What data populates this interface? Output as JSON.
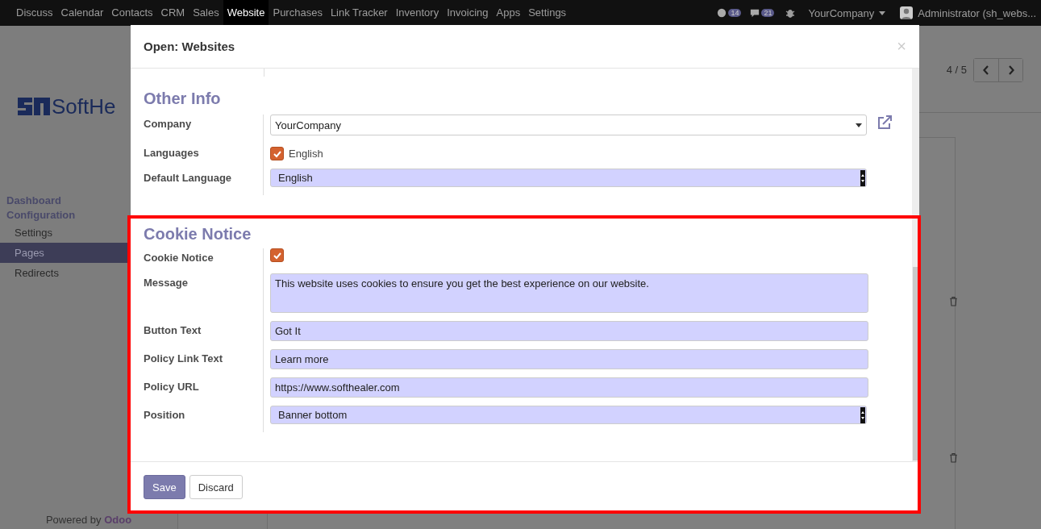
{
  "navbar": {
    "menu": [
      {
        "label": "Discuss",
        "selected": false
      },
      {
        "label": "Calendar",
        "selected": false
      },
      {
        "label": "Contacts",
        "selected": false
      },
      {
        "label": "CRM",
        "selected": false
      },
      {
        "label": "Sales",
        "selected": false
      },
      {
        "label": "Website",
        "selected": true
      },
      {
        "label": "Purchases",
        "selected": false
      },
      {
        "label": "Link Tracker",
        "selected": false
      },
      {
        "label": "Inventory",
        "selected": false
      },
      {
        "label": "Invoicing",
        "selected": false
      },
      {
        "label": "Apps",
        "selected": false
      },
      {
        "label": "Settings",
        "selected": false
      }
    ],
    "counters": [
      {
        "kind": "activity",
        "count": "14"
      },
      {
        "kind": "chat",
        "count": "21"
      }
    ],
    "company": "YourCompany",
    "user": "Administrator (sh_webs..."
  },
  "sidebar": {
    "logo_text": "SoftHe",
    "section": "Dashboard Configuration",
    "items": [
      {
        "label": "Settings",
        "selected": false
      },
      {
        "label": "Pages",
        "selected": true
      },
      {
        "label": "Redirects",
        "selected": false
      }
    ],
    "footer_text": "Powered by",
    "footer_link": "Odoo"
  },
  "pager": {
    "value": "4 / 5"
  },
  "dialog": {
    "title": "Open: Websites",
    "close": "×",
    "sections": [
      {
        "title": "Other Info",
        "fields": [
          {
            "kind": "select",
            "label": "Company",
            "value": "YourCompany",
            "required": false,
            "external_link": true
          },
          {
            "kind": "checklist",
            "label": "Languages",
            "options": [
              {
                "label": "English",
                "checked": true
              }
            ]
          },
          {
            "kind": "select",
            "label": "Default Language",
            "value": "English",
            "required": true
          }
        ]
      },
      {
        "title": "Cookie Notice",
        "fields": [
          {
            "kind": "checkbox",
            "label": "Cookie Notice",
            "checked": true
          },
          {
            "kind": "textarea",
            "label": "Message",
            "value": "This website uses cookies to ensure you get the best experience on our website.",
            "required": true
          },
          {
            "kind": "input",
            "label": "Button Text",
            "value": "Got It",
            "required": true
          },
          {
            "kind": "input",
            "label": "Policy Link Text",
            "value": "Learn more",
            "required": true
          },
          {
            "kind": "input",
            "label": "Policy URL",
            "value": "https://www.softhealer.com",
            "required": true
          },
          {
            "kind": "select",
            "label": "Position",
            "value": "Banner bottom",
            "required": true
          }
        ]
      }
    ],
    "buttons": [
      {
        "label": "Save",
        "primary": true
      },
      {
        "label": "Discard",
        "primary": false
      }
    ]
  }
}
